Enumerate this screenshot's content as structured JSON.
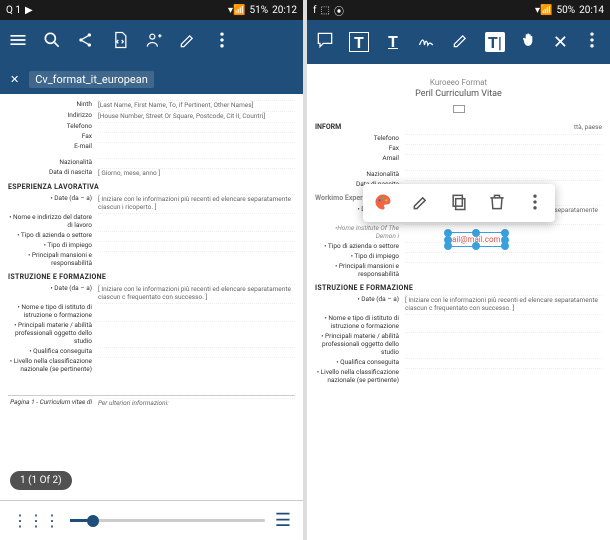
{
  "left": {
    "status": {
      "net": "Q 1",
      "battery": "51%",
      "time": "20:12"
    },
    "filename": "Cv_format_it_european",
    "doc": {
      "labels": {
        "ninth": "Ninth",
        "indirizzo": "Indirizzo",
        "telefono": "Telefono",
        "fax": "Fax",
        "email": "E-mail",
        "nazionalita": "Nazionalità",
        "data_nascita": "Data di nascita"
      },
      "header": "[Last Name, First Name, To, if Pertinent, Other Names]",
      "addr": "[House Number, Street Or Square, Postcode, Cit II, Countri]",
      "giorno": "[ Giorno, mese, anno ]",
      "sect1": "ESPERIENZA LAVORATIVA",
      "date": "• Date (da – a)",
      "note1": "[ Iniziare con le informazioni più recenti ed elencare separatamente ciascun i ricoperto. ]",
      "datore": "• Nome e indirizzo del datore di lavoro",
      "tipo_az": "• Tipo di azienda o settore",
      "tipo_imp": "• Tipo di impiego",
      "mansioni": "• Principali mansioni e responsabilità",
      "sect2": "ISTRUZIONE E FORMAZIONE",
      "note2": "[ Iniziare con le informazioni più recenti ed elencare separatamente ciascun c frequentato con successo. ]",
      "istituto": "• Nome e tipo di istituto di istruzione o formazione",
      "materie": "• Principali materie / abilità professionali oggetto dello studio",
      "qualifica": "• Qualifica conseguita",
      "livello": "• Livello nella classificazione nazionale (se pertinente)",
      "footer_l": "Pagina 1 - Curriculum vitae di",
      "footer_r": "Per ulteriori informazioni:"
    },
    "page_counter": "1 (1 Of 2)"
  },
  "right": {
    "status": {
      "battery": "50%",
      "time": "20:14"
    },
    "doc": {
      "kformat": "Kuroeeo Format",
      "title": "Peril Curriculum Vitae",
      "info": "INFORM",
      "ttta": "ttà, paese",
      "email": "ail@mail.com",
      "workexp": "Workimo Experience",
      "homeinst": "•Home Institute Of The Demon i"
    }
  },
  "colors": {
    "primary": "#1f4e7a",
    "accent": "#3aa0dd",
    "danger": "#d9534f"
  }
}
